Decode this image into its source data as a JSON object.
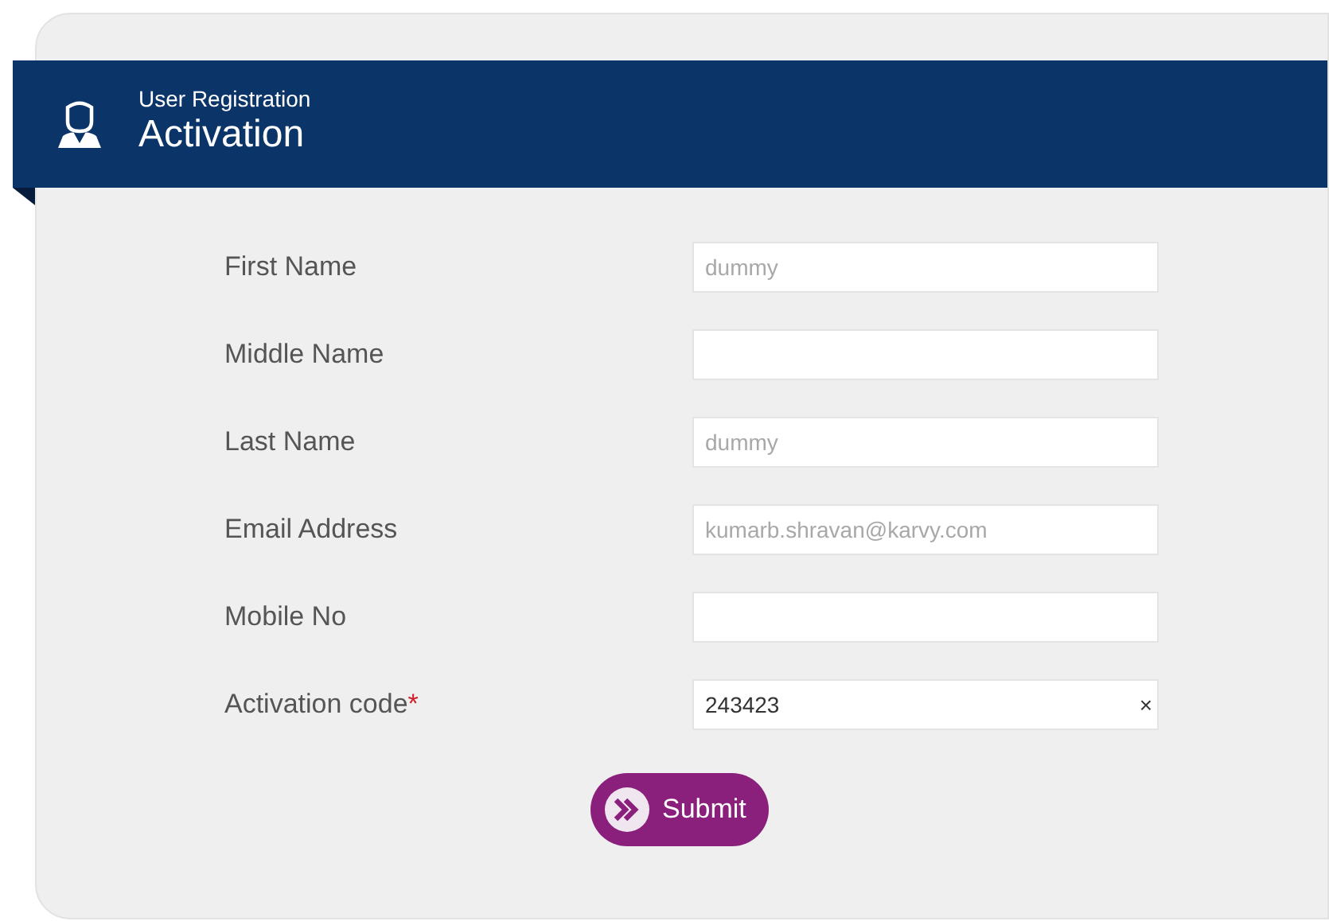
{
  "header": {
    "subtitle": "User Registration",
    "title": "Activation"
  },
  "fields": [
    {
      "label": "First Name",
      "placeholder": "dummy"
    },
    {
      "label": "Middle Name"
    },
    {
      "label": "Last Name",
      "placeholder": "dummy"
    },
    {
      "label": "Email Address",
      "placeholder": "kumarb.shravan@karvy.com"
    },
    {
      "label": "Mobile No"
    },
    {
      "label": "Activation code",
      "required_mark": "*",
      "value": "243423",
      "clear_symbol": "×"
    }
  ],
  "submit": {
    "label": "Submit"
  }
}
